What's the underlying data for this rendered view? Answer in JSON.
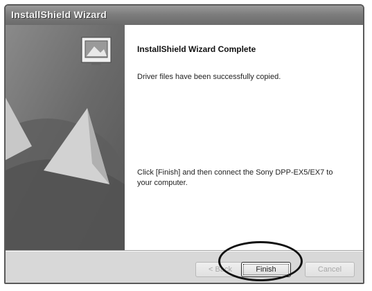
{
  "window": {
    "title": "InstallShield Wizard"
  },
  "banner": {
    "icon": "installer-monitor-icon"
  },
  "content": {
    "heading": "InstallShield Wizard Complete",
    "message_1": "Driver files have been successfully copied.",
    "message_2": "Click [Finish] and then connect the Sony DPP-EX5/EX7 to your computer."
  },
  "buttons": {
    "back_label": "< Back",
    "finish_label": "Finish",
    "cancel_label": "Cancel"
  },
  "colors": {
    "titlebar": "#7d7d7d",
    "banner": "#6e6e6e",
    "content_bg": "#ffffff",
    "button_bar": "#d8d8d8"
  }
}
